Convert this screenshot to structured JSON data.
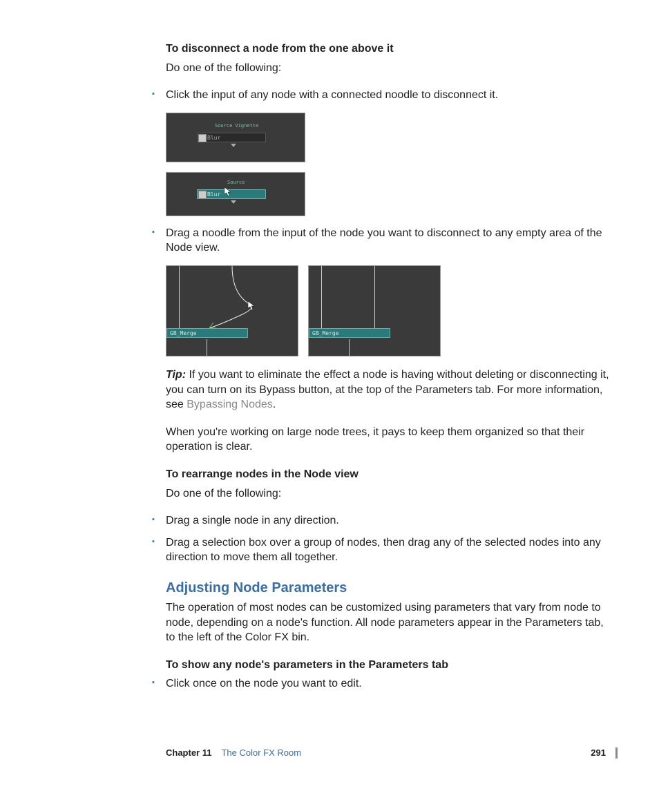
{
  "heading1": "To disconnect a node from the one above it",
  "do_one": "Do one of the following:",
  "bullet1": "Click the input of any node with a connected noodle to disconnect it.",
  "bullet2": "Drag a noodle from the input of the node you want to disconnect to any empty area of the Node view.",
  "tip_label": "Tip:",
  "tip_body_a": "If you want to eliminate the effect a node is having without deleting or disconnecting it, you can turn on its Bypass button, at the top of the Parameters tab. For more information, see ",
  "tip_link": "Bypassing Nodes",
  "tip_body_b": ".",
  "para_large": "When you're working on large node trees, it pays to keep them organized so that their operation is clear.",
  "heading2": "To rearrange nodes in the Node view",
  "bullet3": "Drag a single node in any direction.",
  "bullet4": "Drag a selection box over a group of nodes, then drag any of the selected nodes into any direction to move them all together.",
  "section_title": "Adjusting Node Parameters",
  "section_body": "The operation of most nodes can be customized using parameters that vary from node to node, depending on a node's function. All node parameters appear in the Parameters tab, to the left of the Color FX bin.",
  "heading3": "To show any node's parameters in the Parameters tab",
  "bullet5": "Click once on the node you want to edit.",
  "footer": {
    "chapter": "Chapter 11",
    "title": "The Color FX Room",
    "page": "291"
  },
  "fig": {
    "blur": "Blur",
    "merge": "GB_Merge",
    "source": "Source",
    "src_vig": "Source Vignette"
  }
}
